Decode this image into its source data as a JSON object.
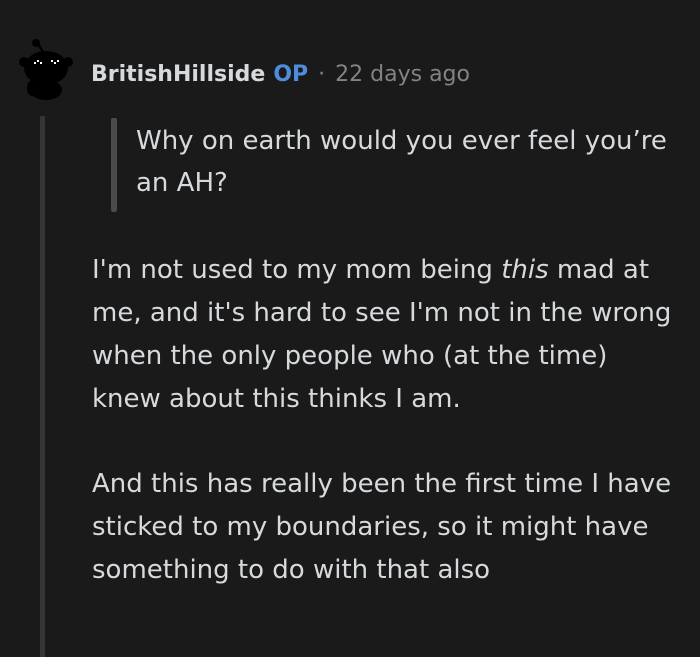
{
  "comment": {
    "author": "BritishHillside",
    "op_badge": "OP",
    "separator": "·",
    "timestamp": "22 days ago",
    "avatar_icon": "snoo-avatar-icon",
    "quote": "Why on earth would you ever feel you’re an AH?",
    "paragraph1": {
      "before": "I'm not used to my mom being ",
      "emphasis": "this",
      "after": " mad at me, and it's hard to see I'm not in the wrong when the only people who (at the time) knew about this thinks I am."
    },
    "paragraph2": "And this has really been the first time I have sticked to my boundaries, so it might have something to do with that also"
  },
  "colors": {
    "background": "#1a1a1b",
    "text": "#d7dadc",
    "op_badge": "#4f8cd9",
    "meta": "#818384",
    "thread_line": "#343536"
  }
}
